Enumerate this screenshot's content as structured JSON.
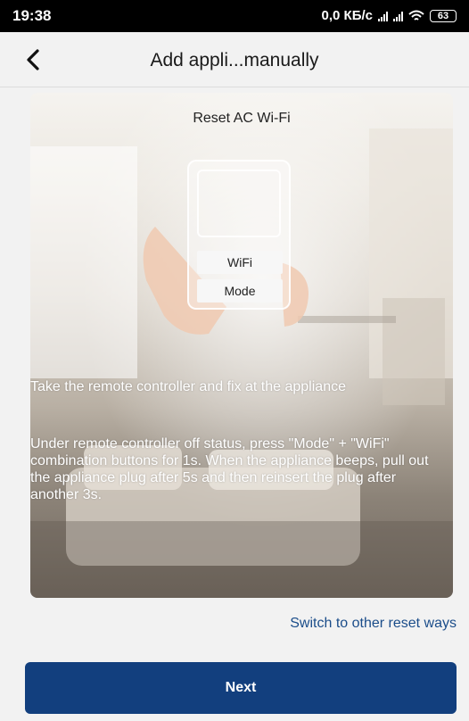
{
  "status_bar": {
    "time": "19:38",
    "net_speed": "0,0 КБ/с",
    "battery": "63"
  },
  "header": {
    "title": "Add appli...manually"
  },
  "guide": {
    "title": "Reset AC Wi-Fi",
    "remote_button_wifi": "WiFi",
    "remote_button_mode": "Mode",
    "instruction_1": "Take the remote controller and fix at the appliance",
    "instruction_2": "Under remote controller off status, press \"Mode\" + \"WiFi\" combination buttons for 1s. When the appliance beeps, pull out the appliance plug after 5s and then reinsert the plug after another 3s."
  },
  "switch_link": "Switch to other reset ways",
  "next_button": "Next",
  "colors": {
    "primary": "#123f7e",
    "link": "#1b4d8a",
    "background": "#f2f2f2"
  }
}
